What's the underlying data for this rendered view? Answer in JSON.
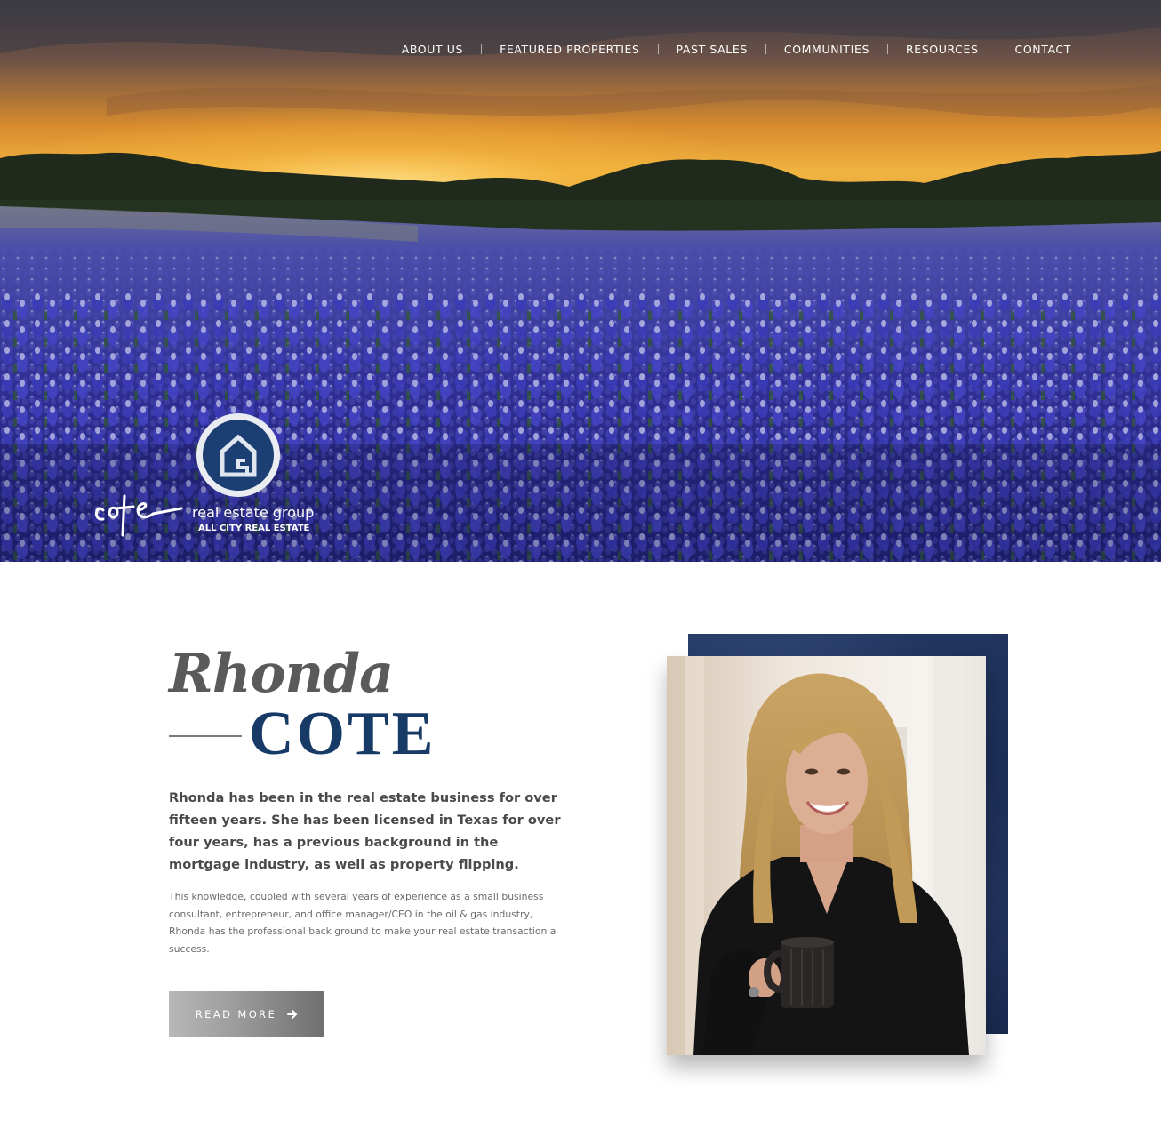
{
  "nav": {
    "items": [
      {
        "label": "ABOUT US"
      },
      {
        "label": "FEATURED PROPERTIES"
      },
      {
        "label": "PAST SALES"
      },
      {
        "label": "COMMUNITIES"
      },
      {
        "label": "RESOURCES"
      },
      {
        "label": "CONTACT"
      }
    ]
  },
  "logo": {
    "script_text": "cote",
    "tagline": "real estate group",
    "brokerage": "ALL CITY REAL ESTATE",
    "emblem_icon": "house-g-emblem-icon"
  },
  "hero": {
    "image": "bluebonnet-field-sunset"
  },
  "about": {
    "first_name": "Rhonda",
    "last_name": "COTE",
    "lead": "Rhonda has been in the real estate business for over fifteen years. She has been licensed in Texas for over four years, has a previous background in the mortgage industry, as well as property flipping.",
    "body": "This knowledge, coupled with several years of experience as a small business consultant, entrepreneur, and office manager/CEO in the oil & gas industry, Rhonda has the professional back ground to make your real estate transaction a success.",
    "read_more_label": "READ MORE",
    "read_more_icon": "arrow-right-icon",
    "portrait": "agent-portrait-with-mug"
  },
  "colors": {
    "brand_navy": "#173a66",
    "backdrop_navy": "#1a2d54",
    "button_gray": "#9a9a9a"
  }
}
